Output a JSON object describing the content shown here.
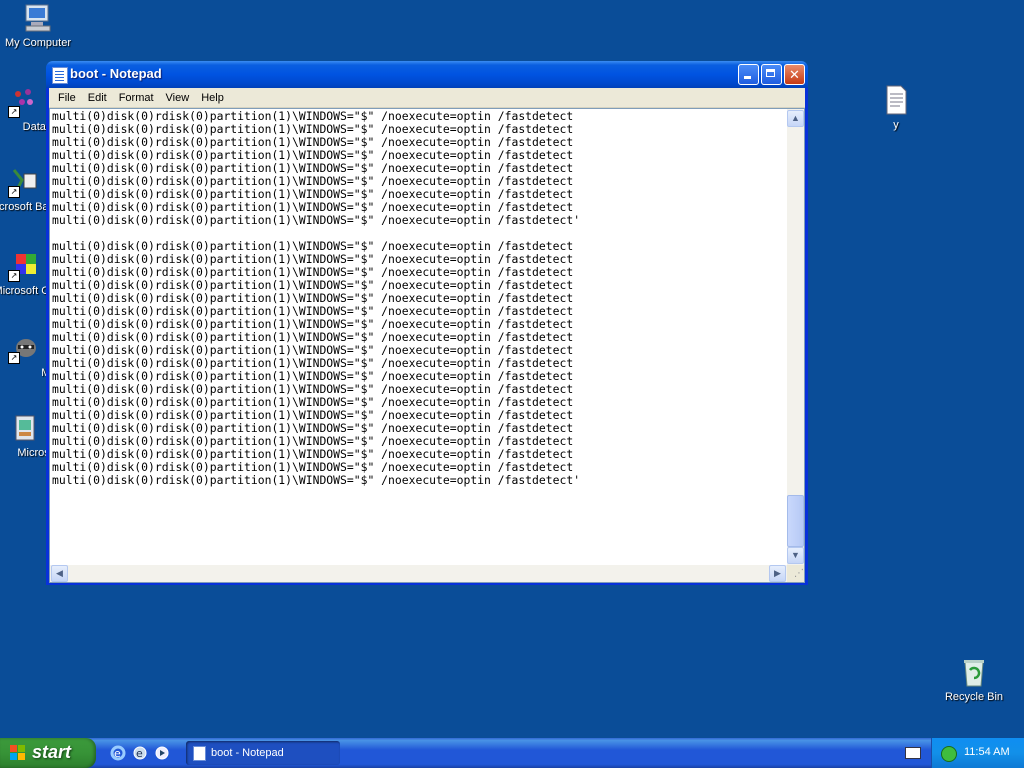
{
  "desktop": {
    "icons": [
      {
        "label": "My Computer",
        "icon": "my-computer-icon"
      },
      {
        "label": "DataWa",
        "icon": "datawarehouse-shortcut-icon"
      },
      {
        "label": "Microsoft Basic",
        "icon": "visual-basic-shortcut-icon"
      },
      {
        "label": "Microsoft C++",
        "icon": "visual-cpp-shortcut-icon"
      },
      {
        "label": "Myp",
        "icon": "raccoon-shortcut-icon"
      },
      {
        "label": "Microsoft",
        "icon": "microsoft-installer-icon"
      },
      {
        "label": "y",
        "icon": "text-document-icon"
      },
      {
        "label": "Recycle Bin",
        "icon": "recycle-bin-icon"
      }
    ]
  },
  "window": {
    "title": "boot - Notepad",
    "menu": [
      "File",
      "Edit",
      "Format",
      "View",
      "Help"
    ],
    "lines": [
      "multi(0)disk(0)rdisk(0)partition(1)\\WINDOWS=\"$\" /noexecute=optin /fastdetect",
      "multi(0)disk(0)rdisk(0)partition(1)\\WINDOWS=\"$\" /noexecute=optin /fastdetect",
      "multi(0)disk(0)rdisk(0)partition(1)\\WINDOWS=\"$\" /noexecute=optin /fastdetect",
      "multi(0)disk(0)rdisk(0)partition(1)\\WINDOWS=\"$\" /noexecute=optin /fastdetect",
      "multi(0)disk(0)rdisk(0)partition(1)\\WINDOWS=\"$\" /noexecute=optin /fastdetect",
      "multi(0)disk(0)rdisk(0)partition(1)\\WINDOWS=\"$\" /noexecute=optin /fastdetect",
      "multi(0)disk(0)rdisk(0)partition(1)\\WINDOWS=\"$\" /noexecute=optin /fastdetect",
      "multi(0)disk(0)rdisk(0)partition(1)\\WINDOWS=\"$\" /noexecute=optin /fastdetect",
      "multi(0)disk(0)rdisk(0)partition(1)\\WINDOWS=\"$\" /noexecute=optin /fastdetect'",
      "",
      "multi(0)disk(0)rdisk(0)partition(1)\\WINDOWS=\"$\" /noexecute=optin /fastdetect",
      "multi(0)disk(0)rdisk(0)partition(1)\\WINDOWS=\"$\" /noexecute=optin /fastdetect",
      "multi(0)disk(0)rdisk(0)partition(1)\\WINDOWS=\"$\" /noexecute=optin /fastdetect",
      "multi(0)disk(0)rdisk(0)partition(1)\\WINDOWS=\"$\" /noexecute=optin /fastdetect",
      "multi(0)disk(0)rdisk(0)partition(1)\\WINDOWS=\"$\" /noexecute=optin /fastdetect",
      "multi(0)disk(0)rdisk(0)partition(1)\\WINDOWS=\"$\" /noexecute=optin /fastdetect",
      "multi(0)disk(0)rdisk(0)partition(1)\\WINDOWS=\"$\" /noexecute=optin /fastdetect",
      "multi(0)disk(0)rdisk(0)partition(1)\\WINDOWS=\"$\" /noexecute=optin /fastdetect",
      "multi(0)disk(0)rdisk(0)partition(1)\\WINDOWS=\"$\" /noexecute=optin /fastdetect",
      "multi(0)disk(0)rdisk(0)partition(1)\\WINDOWS=\"$\" /noexecute=optin /fastdetect",
      "multi(0)disk(0)rdisk(0)partition(1)\\WINDOWS=\"$\" /noexecute=optin /fastdetect",
      "multi(0)disk(0)rdisk(0)partition(1)\\WINDOWS=\"$\" /noexecute=optin /fastdetect",
      "multi(0)disk(0)rdisk(0)partition(1)\\WINDOWS=\"$\" /noexecute=optin /fastdetect",
      "multi(0)disk(0)rdisk(0)partition(1)\\WINDOWS=\"$\" /noexecute=optin /fastdetect",
      "multi(0)disk(0)rdisk(0)partition(1)\\WINDOWS=\"$\" /noexecute=optin /fastdetect",
      "multi(0)disk(0)rdisk(0)partition(1)\\WINDOWS=\"$\" /noexecute=optin /fastdetect",
      "multi(0)disk(0)rdisk(0)partition(1)\\WINDOWS=\"$\" /noexecute=optin /fastdetect",
      "multi(0)disk(0)rdisk(0)partition(1)\\WINDOWS=\"$\" /noexecute=optin /fastdetect",
      "multi(0)disk(0)rdisk(0)partition(1)\\WINDOWS=\"$\" /noexecute=optin /fastdetect'"
    ]
  },
  "taskbar": {
    "start_label": "start",
    "task_label": "boot - Notepad",
    "clock": "11:54 AM"
  },
  "colors": {
    "desktop": "#0a4d98",
    "start_green": "#379337",
    "taskbar_blue": "#2157d7"
  }
}
